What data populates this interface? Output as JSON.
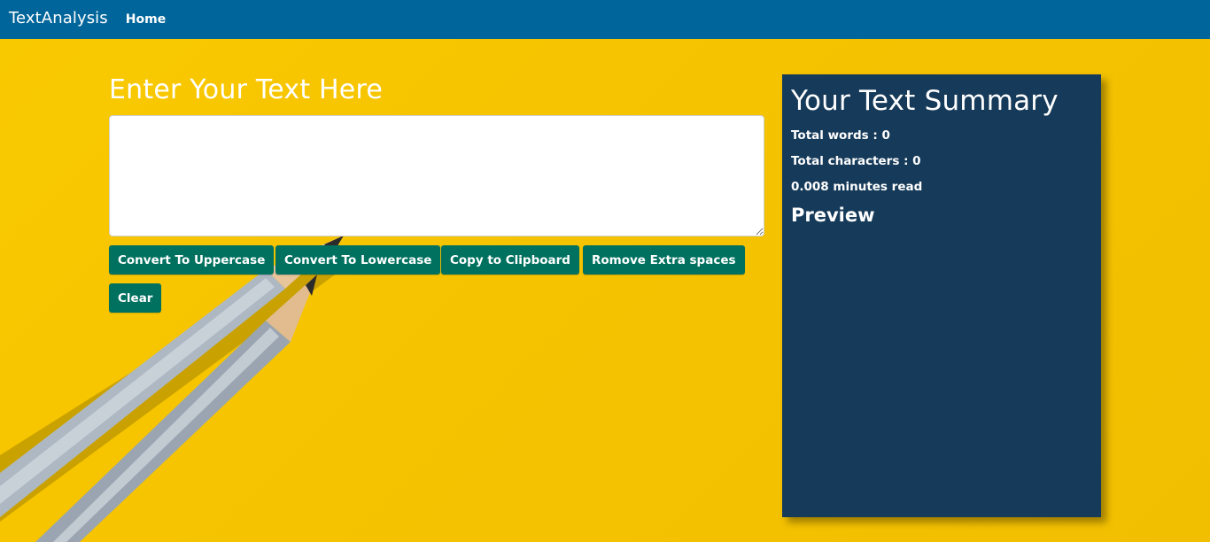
{
  "nav": {
    "brand": "TextAnalysis",
    "home": "Home"
  },
  "editor": {
    "title": "Enter Your Text Here",
    "text_value": "",
    "buttons": {
      "uppercase": "Convert To Uppercase",
      "lowercase": "Convert To Lowercase",
      "copy": "Copy to Clipboard",
      "extra_spaces": "Romove Extra spaces",
      "clear": "Clear"
    }
  },
  "summary": {
    "title": "Your Text Summary",
    "words": "Total words : 0",
    "characters": "Total characters : 0",
    "read_time": "0.008 minutes read",
    "preview_title": "Preview",
    "preview_text": ""
  },
  "colors": {
    "navbar": "#00659a",
    "button": "#00715f",
    "panel": "#163a59",
    "background": "#f6c500"
  }
}
